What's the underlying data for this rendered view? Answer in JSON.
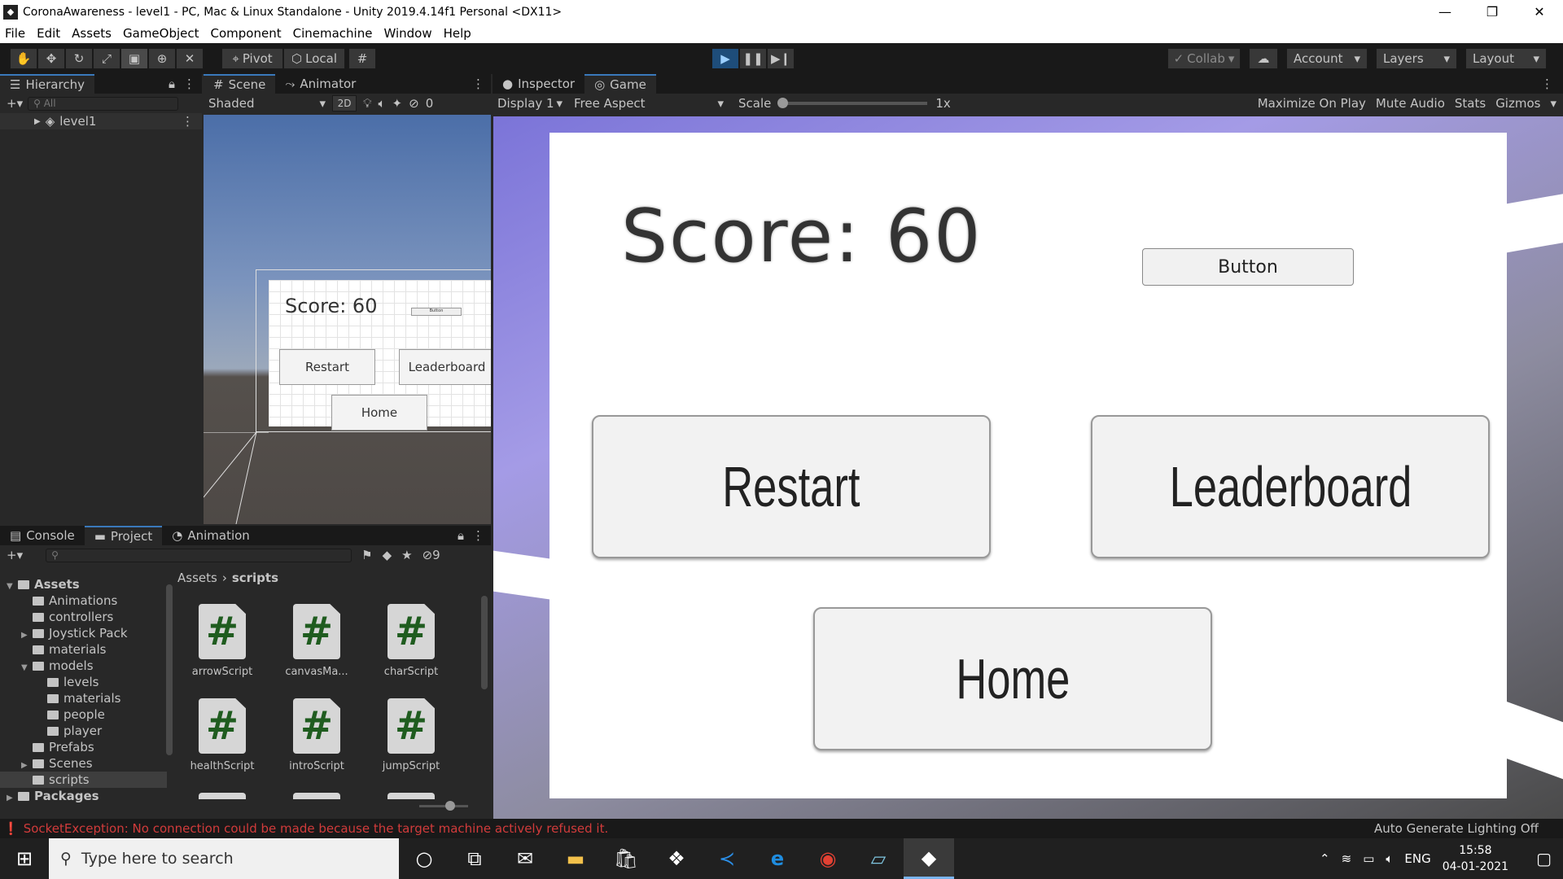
{
  "window": {
    "title": "CoronaAwareness - level1 - PC, Mac & Linux Standalone - Unity 2019.4.14f1 Personal <DX11>"
  },
  "menu": [
    "File",
    "Edit",
    "Assets",
    "GameObject",
    "Component",
    "Cinemachine",
    "Window",
    "Help"
  ],
  "toolbar": {
    "pivot": "Pivot",
    "local": "Local",
    "collab": "Collab",
    "account": "Account",
    "layers": "Layers",
    "layout": "Layout"
  },
  "hierarchy": {
    "tab": "Hierarchy",
    "search_placeholder": "All",
    "scene": "level1"
  },
  "scene_panel": {
    "tabs": [
      "Scene",
      "Animator"
    ],
    "shading": "Shaded",
    "mode2d": "2D",
    "hidden_count": "0",
    "preview": {
      "score": "Score: 60",
      "button": "Button",
      "restart": "Restart",
      "leaderboard": "Leaderboard",
      "home": "Home"
    }
  },
  "game_panel": {
    "tabs": [
      "Inspector",
      "Game"
    ],
    "display": "Display 1",
    "aspect": "Free Aspect",
    "scale_label": "Scale",
    "scale_value": "1x",
    "options": [
      "Maximize On Play",
      "Mute Audio",
      "Stats",
      "Gizmos"
    ]
  },
  "game": {
    "score": "Score: 60",
    "button": "Button",
    "restart": "Restart",
    "leaderboard": "Leaderboard",
    "home": "Home"
  },
  "bottom": {
    "tabs": [
      "Console",
      "Project",
      "Animation"
    ],
    "hidden_count": "9",
    "breadcrumb": [
      "Assets",
      "scripts"
    ],
    "tree": [
      {
        "label": "Assets",
        "depth": 0,
        "arrow": "open",
        "bold": true
      },
      {
        "label": "Animations",
        "depth": 1,
        "arrow": ""
      },
      {
        "label": "controllers",
        "depth": 1,
        "arrow": ""
      },
      {
        "label": "Joystick Pack",
        "depth": 1,
        "arrow": "closed"
      },
      {
        "label": "materials",
        "depth": 1,
        "arrow": ""
      },
      {
        "label": "models",
        "depth": 1,
        "arrow": "open"
      },
      {
        "label": "levels",
        "depth": 2,
        "arrow": ""
      },
      {
        "label": "materials",
        "depth": 2,
        "arrow": ""
      },
      {
        "label": "people",
        "depth": 2,
        "arrow": ""
      },
      {
        "label": "player",
        "depth": 2,
        "arrow": ""
      },
      {
        "label": "Prefabs",
        "depth": 1,
        "arrow": ""
      },
      {
        "label": "Scenes",
        "depth": 1,
        "arrow": "closed"
      },
      {
        "label": "scripts",
        "depth": 1,
        "arrow": "",
        "selected": true
      },
      {
        "label": "Packages",
        "depth": 0,
        "arrow": "closed",
        "bold": true
      }
    ],
    "assets": [
      "arrowScript",
      "canvasMa...",
      "charScript",
      "healthScript",
      "introScript",
      "jumpScript"
    ]
  },
  "status": {
    "error": "SocketException: No connection could be made because the target machine actively refused it.",
    "lighting": "Auto Generate Lighting Off"
  },
  "taskbar": {
    "search_placeholder": "Type here to search",
    "lang": "ENG",
    "time": "15:58",
    "date": "04-01-2021"
  },
  "colors": {
    "accent": "#3a79bb",
    "error": "#d13b3b",
    "game_bg": "#ffffff"
  }
}
